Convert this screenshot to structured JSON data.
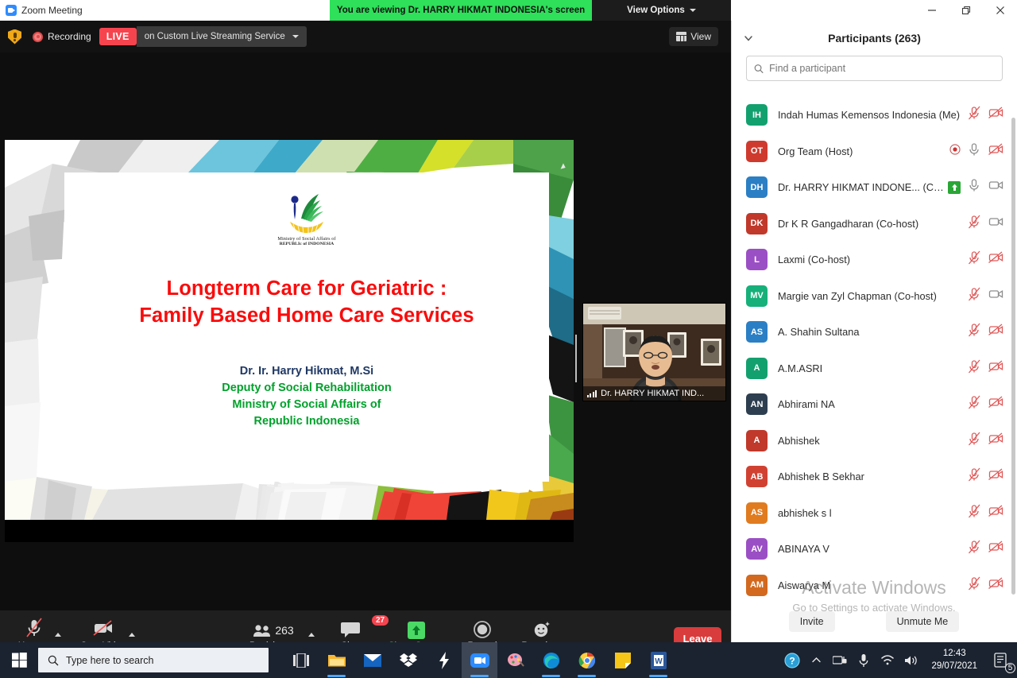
{
  "titlebar": {
    "app_title": "Zoom Meeting",
    "view_banner": "You are viewing Dr. HARRY HIKMAT INDONESIA's screen",
    "view_options_label": "View Options",
    "minimize_label": "Minimize",
    "restore_label": "Restore",
    "close_label": "Close"
  },
  "statusbar": {
    "recording_label": "Recording",
    "live_chip": "LIVE",
    "live_service": "on Custom Live Streaming Service",
    "view_button": "View"
  },
  "slide": {
    "logo_line1": "Ministry of Social Affairs of",
    "logo_line2": "REPUBLIc of INDONESIA",
    "title_line1": "Longterm Care for Geriatric :",
    "title_line2": "Family Based Home Care Services",
    "author": "Dr. Ir. Harry Hikmat, M.Si",
    "org_line1": "Deputy of Social Rehabilitation",
    "org_line2": "Ministry of Social Affairs of",
    "org_line3": "Republic Indonesia",
    "title_color": "#fa0c0c",
    "author_color": "#1f3864",
    "org_color": "#00a12b"
  },
  "thumbnail": {
    "name": "Dr. HARRY HIKMAT IND..."
  },
  "toolbar": {
    "unmute_label": "Unmute",
    "start_video_label": "Start Video",
    "participants_label": "Participants",
    "participants_count": "263",
    "chat_label": "Chat",
    "chat_badge": "27",
    "share_screen_label": "Share Screen",
    "record_label": "Record",
    "reactions_label": "Reactions",
    "leave_label": "Leave",
    "share_color": "#4bd865",
    "leave_color": "#d93c3c"
  },
  "panel": {
    "title": "Participants (263)",
    "search_placeholder": "Find a participant",
    "invite_label": "Invite",
    "unmute_me_label": "Unmute Me",
    "watermark_line1": "Activate Windows",
    "watermark_line2": "Go to Settings to activate Windows.",
    "participants": [
      {
        "initials": "IH",
        "color": "#13a06f",
        "name": "Indah Humas Kemensos Indonesia (Me)",
        "mic": "muted",
        "video": "off",
        "recording": false,
        "sharing": false
      },
      {
        "initials": "OT",
        "color": "#cf3a2e",
        "name": "Org Team (Host)",
        "mic": "on",
        "video": "off",
        "recording": true,
        "sharing": false
      },
      {
        "initials": "DH",
        "color": "#2b7fc4",
        "name": "Dr. HARRY HIKMAT INDONE...  (Co-host)",
        "mic": "on",
        "video": "on",
        "recording": false,
        "sharing": true
      },
      {
        "initials": "DK",
        "color": "#c0392b",
        "name": "Dr K R Gangadharan (Co-host)",
        "mic": "muted",
        "video": "on",
        "recording": false,
        "sharing": false
      },
      {
        "initials": "L",
        "color": "#9b4fc4",
        "name": "Laxmi (Co-host)",
        "mic": "muted",
        "video": "off",
        "recording": false,
        "sharing": false
      },
      {
        "initials": "MV",
        "color": "#16b07a",
        "name": "Margie van Zyl Chapman (Co-host)",
        "mic": "muted",
        "video": "on",
        "recording": false,
        "sharing": false
      },
      {
        "initials": "AS",
        "color": "#2b7fc4",
        "name": "A. Shahin Sultana",
        "mic": "muted",
        "video": "off",
        "recording": false,
        "sharing": false
      },
      {
        "initials": "A",
        "color": "#13a06f",
        "name": "A.M.ASRI",
        "mic": "muted",
        "video": "off",
        "recording": false,
        "sharing": false
      },
      {
        "initials": "AN",
        "color": "#2d3e50",
        "name": "Abhirami NA",
        "mic": "muted",
        "video": "off",
        "recording": false,
        "sharing": false
      },
      {
        "initials": "A",
        "color": "#c0392b",
        "name": "Abhishek",
        "mic": "muted",
        "video": "off",
        "recording": false,
        "sharing": false
      },
      {
        "initials": "AB",
        "color": "#d14132",
        "name": "Abhishek B Sekhar",
        "mic": "muted",
        "video": "off",
        "recording": false,
        "sharing": false
      },
      {
        "initials": "AS",
        "color": "#e07b1f",
        "name": "abhishek s l",
        "mic": "muted",
        "video": "off",
        "recording": false,
        "sharing": false
      },
      {
        "initials": "AV",
        "color": "#9b4fc4",
        "name": "ABINAYA V",
        "mic": "muted",
        "video": "off",
        "recording": false,
        "sharing": false
      },
      {
        "initials": "AM",
        "color": "#d2691e",
        "name": "Aiswarya M",
        "mic": "muted",
        "video": "off",
        "recording": false,
        "sharing": false
      }
    ]
  },
  "taskbar": {
    "search_placeholder": "Type here to search",
    "time": "12:43",
    "date": "29/07/2021",
    "notification_count": "5",
    "apps": [
      {
        "name": "task-view",
        "label": "Task View"
      },
      {
        "name": "file-explorer",
        "label": "File Explorer"
      },
      {
        "name": "mail",
        "label": "Mail"
      },
      {
        "name": "dropbox",
        "label": "Dropbox"
      },
      {
        "name": "lightning-app",
        "label": "Streamlabs"
      },
      {
        "name": "zoom",
        "label": "Zoom"
      },
      {
        "name": "paint",
        "label": "Paint 3D"
      },
      {
        "name": "edge",
        "label": "Microsoft Edge"
      },
      {
        "name": "chrome",
        "label": "Google Chrome"
      },
      {
        "name": "sticky-notes",
        "label": "Sticky Notes"
      },
      {
        "name": "word",
        "label": "Microsoft Word"
      }
    ]
  }
}
